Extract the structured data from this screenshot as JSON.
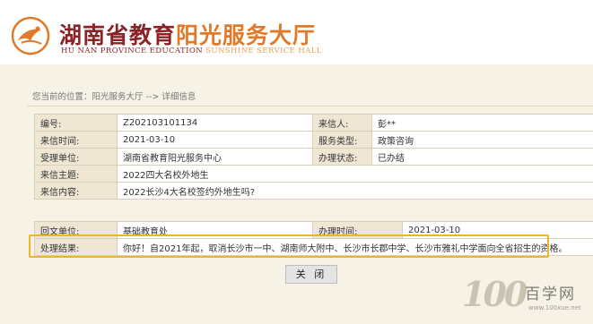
{
  "header": {
    "title_part1": "湖南省教育",
    "title_part2": "阳光服务大厅",
    "subtitle_part1": "HU NAN PROVINCE EDUCATION",
    "subtitle_part2": "SUNSHINE SERVICE HALL"
  },
  "breadcrumb": {
    "prefix": "您当前的位置：",
    "home": "阳光服务大厅",
    "separator": "-->",
    "current": "详细信息"
  },
  "colors": {
    "highlight": "#f0b428",
    "brand_dark": "#8b2326",
    "brand_light": "#e07a2a"
  },
  "info": {
    "number_label": "编号:",
    "number_value": "Z202103101134",
    "sender_label": "来信人:",
    "sender_value": "彭**",
    "date_label": "来信时间:",
    "date_value": "2021-03-10",
    "service_type_label": "服务类型:",
    "service_type_value": "政策咨询",
    "handler_label": "受理单位:",
    "handler_value": "湖南省教育阳光服务中心",
    "status_label": "办理状态:",
    "status_value": "已办结",
    "subject_label": "来信主题:",
    "subject_value": "2022四大名校外地生",
    "content_label": "来信内容:",
    "content_value": "2022长沙4大名校签约外地生吗?"
  },
  "reply": {
    "unit_label": "回文单位:",
    "unit_value": "基础教育处",
    "time_label": "办理时间:",
    "time_value": "2021-03-10",
    "result_label": "处理结果:",
    "result_value": "你好！自2021年起，取消长沙市一中、湖南师大附中、长沙市长郡中学、长沙市雅礼中学面向全省招生的资格。"
  },
  "actions": {
    "close_label": "关 闭"
  },
  "watermark": {
    "number": "100",
    "name": "百学网",
    "url": "www.100xue.net"
  }
}
